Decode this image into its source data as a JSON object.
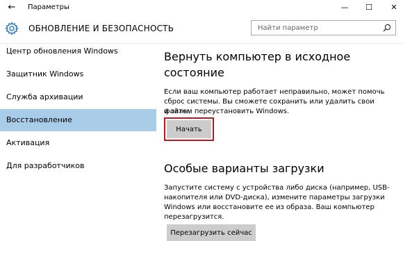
{
  "window": {
    "title": "Параметры",
    "back_icon": "←",
    "minimize_icon": "—",
    "maximize_icon": "☐",
    "close_icon": "✕"
  },
  "header": {
    "section_title": "ОБНОВЛЕНИЕ И БЕЗОПАСНОСТЬ",
    "search_placeholder": "Найти параметр"
  },
  "sidebar": {
    "items": [
      {
        "label": "Центр обновления Windows"
      },
      {
        "label": "Защитник Windows"
      },
      {
        "label": "Служба архивации"
      },
      {
        "label": "Восстановление"
      },
      {
        "label": "Активация"
      },
      {
        "label": "Для разработчиков"
      }
    ],
    "active_index": 3
  },
  "reset": {
    "heading_line1": "Вернуть компьютер в исходное",
    "heading_line2": "состояние",
    "desc_line1": "Если ваш компьютер работает неправильно, может помочь",
    "desc_line2": "сброс системы. Вы сможете сохранить или удалить свои файлы,",
    "desc_line3": "и затем переустановить Windows.",
    "button_label": "Начать"
  },
  "advanced": {
    "heading": "Особые варианты загрузки",
    "desc_line1": "Запустите систему с устройства либо диска (например, USB-",
    "desc_line2": "накопителя или DVD-диска), измените параметры загрузки",
    "desc_line3": "Windows или восстановите ее из образа. Ваш компьютер",
    "desc_line4": "перезагрузится.",
    "button_label": "Перезагрузить сейчас"
  },
  "colors": {
    "active_nav_bg": "#a9cce9",
    "button_bg": "#cccccc",
    "highlight_border": "#c0171d",
    "accent": "#1f6fb5"
  }
}
